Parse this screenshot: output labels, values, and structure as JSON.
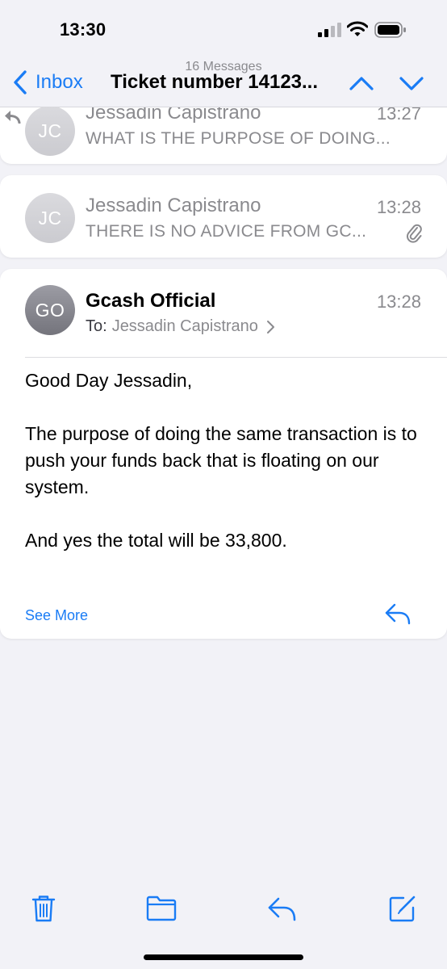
{
  "status_bar": {
    "time": "13:30"
  },
  "nav": {
    "back_label": "Inbox",
    "message_count": "16 Messages",
    "title": "Ticket number 14123..."
  },
  "messages": [
    {
      "avatar": "JC",
      "sender": "Jessadin Capistrano",
      "time": "13:27",
      "preview": "WHAT IS THE PURPOSE OF DOING...",
      "replied": true
    },
    {
      "avatar": "JC",
      "sender": "Jessadin Capistrano",
      "time": "13:28",
      "preview": "THERE IS NO ADVICE FROM GC...",
      "has_attachment": true
    },
    {
      "avatar": "GO",
      "sender": "Gcash Official",
      "time": "13:28",
      "to_label": "To:",
      "to_name": "Jessadin Capistrano",
      "body": [
        "Good Day Jessadin,",
        "The purpose of doing the same transaction is to push your funds back that is floating on our system.",
        "And yes the total will be 33,800."
      ],
      "see_more": "See More"
    }
  ],
  "toolbar": {
    "icons": [
      "trash-icon",
      "folder-icon",
      "reply-icon",
      "compose-icon"
    ]
  },
  "colors": {
    "accent": "#1a7cf5",
    "secondary_text": "#8a8a8e",
    "background": "#f2f2f7"
  }
}
